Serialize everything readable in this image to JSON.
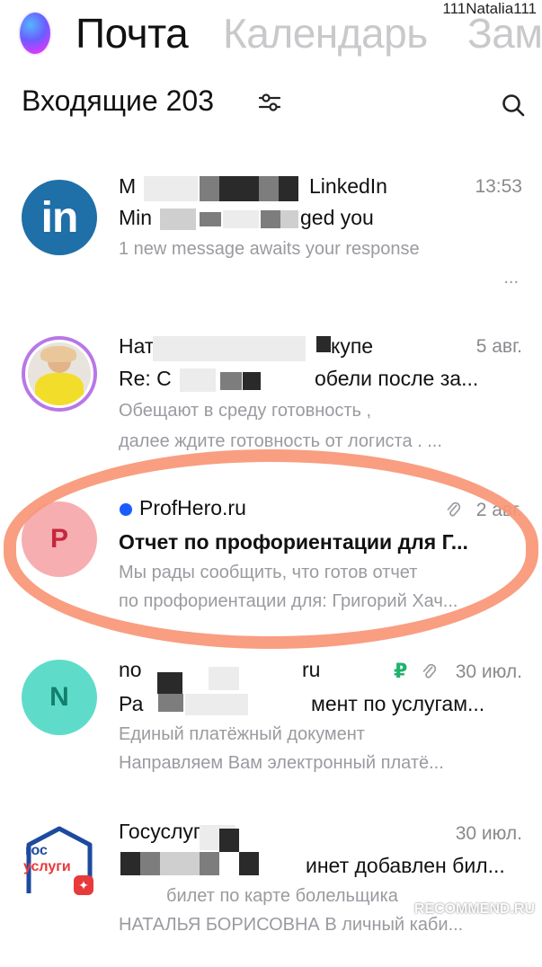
{
  "watermark_top": "111Natalia111",
  "watermark_bottom": "RECOMMEND.RU",
  "header": {
    "tabs": [
      {
        "label": "Почта"
      },
      {
        "label": "Календарь"
      },
      {
        "label": "Зам"
      }
    ],
    "folder_title": "Входящие 203"
  },
  "messages": [
    {
      "sender_start": "M",
      "sender_end": "LinkedIn",
      "time": "13:53",
      "subject_start": "Min",
      "subject_end": "ged you",
      "preview1": "1 new message awaits your response",
      "preview2": "...",
      "avatar_text": "in",
      "avatar_color": "#1f6fa8"
    },
    {
      "sender_start": "Нат",
      "sender_end": "купе",
      "time": "5 авг.",
      "subject_start": "Re: С",
      "subject_end": "обели после за...",
      "preview1": "Обещают в среду готовность ,",
      "preview2": "далее ждите готовность от логиста . ..."
    },
    {
      "sender": "ProfHero.ru",
      "time": "2 авг.",
      "subject": "Отчет по профориентации для Г...",
      "preview1": "Мы рады сообщить, что готов отчет",
      "preview2": "по профориентации для: Григорий Хач...",
      "avatar_text": "P",
      "avatar_color": "#f6aeb0",
      "unread_dot_color": "#1a5cff"
    },
    {
      "sender_start": "no",
      "sender_end": "ru",
      "currency": "₽",
      "time": "30 июл.",
      "subject_start": "Ра",
      "subject_end": "мент по услугам...",
      "preview1": "Единый платёжный документ",
      "preview2": "Направляем Вам электронный платё...",
      "avatar_text": "N",
      "avatar_color": "#5fdcc9"
    },
    {
      "sender_start": "Госуслуги",
      "time": "30 июл.",
      "subject_end": "инет добавлен бил...",
      "preview1": "билет по карте болельщика",
      "preview2": "НАТАЛЬЯ БОРИСОВНА В личный каби...",
      "avatar_line1": "гос",
      "avatar_line2": "услуги"
    }
  ]
}
